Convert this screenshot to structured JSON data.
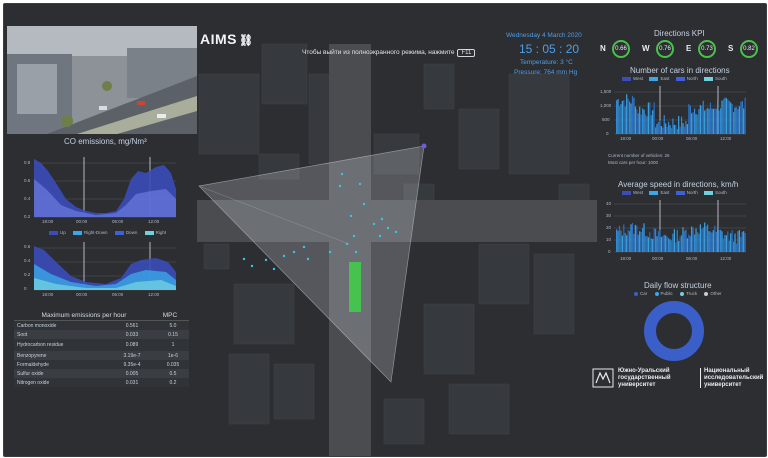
{
  "branding": {
    "logo": "AIMS"
  },
  "hint": {
    "text": "Чтобы выйти из полноэкранного режима, нажмите",
    "key": "F11"
  },
  "info": {
    "date": "Wednesday 4 March 2020",
    "time": "15 : 05 : 20",
    "temperature": "Temperature: 3 °C",
    "pressure": "Pressure: 764 mm Hg"
  },
  "co_chart": {
    "title": "CO emissions, mg/Nm³",
    "y_ticks": [
      "0.8",
      "0.6",
      "0.4",
      "0.2",
      "0"
    ],
    "x_ticks": [
      "18:00",
      "00:00",
      "06:00",
      "12:00"
    ],
    "legend": [
      "Up",
      "Right-Down",
      "Down",
      "Right"
    ],
    "y_ticks2": [
      "0.6",
      "0.4",
      "0.2",
      "0"
    ],
    "x_ticks2": [
      "18:00",
      "00:00",
      "06:00",
      "12:00"
    ]
  },
  "emissions_table": {
    "headers": [
      "Maximum emissions per hour",
      "MPC"
    ],
    "rows": [
      [
        "Carbon monoxide",
        "0.561",
        "5.0"
      ],
      [
        "Soot",
        "0.033",
        "0.15"
      ],
      [
        "Hydrocarbon residue",
        "0.089",
        "1"
      ],
      [
        "Benzopyrene",
        "3.19e-7",
        "1e-6"
      ],
      [
        "Formaldehyde",
        "9.35e-4",
        "0.035"
      ],
      [
        "Sulfur oxide",
        "0.005",
        "0.5"
      ],
      [
        "Nitrogen oxide",
        "0.031",
        "0.2"
      ]
    ]
  },
  "kpi": {
    "title": "Directions KPI",
    "items": [
      {
        "dir": "N",
        "value": "0.66"
      },
      {
        "dir": "W",
        "value": "0.76"
      },
      {
        "dir": "E",
        "value": "0.73"
      },
      {
        "dir": "S",
        "value": "0.82"
      }
    ],
    "ring_color": "#49c24a"
  },
  "cars_chart": {
    "title": "Number of cars in directions",
    "legend": [
      "West",
      "East",
      "North",
      "South"
    ],
    "y_ticks": [
      "1,500",
      "1,000",
      "500",
      "0"
    ],
    "x_ticks": [
      "18:00",
      "00:00",
      "06:00",
      "12:00"
    ],
    "note1": "Current number of vehicles: 26",
    "note2": "Most cars per hour: 1000"
  },
  "speed_chart": {
    "title": "Average speed in directions, km/h",
    "legend": [
      "West",
      "East",
      "North",
      "South"
    ],
    "y_ticks": [
      "40",
      "30",
      "20",
      "10",
      "0"
    ],
    "x_ticks": [
      "18:00",
      "00:00",
      "06:00",
      "12:00"
    ]
  },
  "flow_chart": {
    "title": "Daily flow structure",
    "legend": [
      "Car",
      "Public",
      "Truck",
      "Other"
    ],
    "color": "#3b5fc9"
  },
  "university": {
    "name_left": "Южно-Уральский государственный университет",
    "name_right": "Национальный исследовательский университет"
  },
  "colors": {
    "accent": "#2e7fd6",
    "background": "#2d2f33",
    "green": "#3fd14a"
  }
}
